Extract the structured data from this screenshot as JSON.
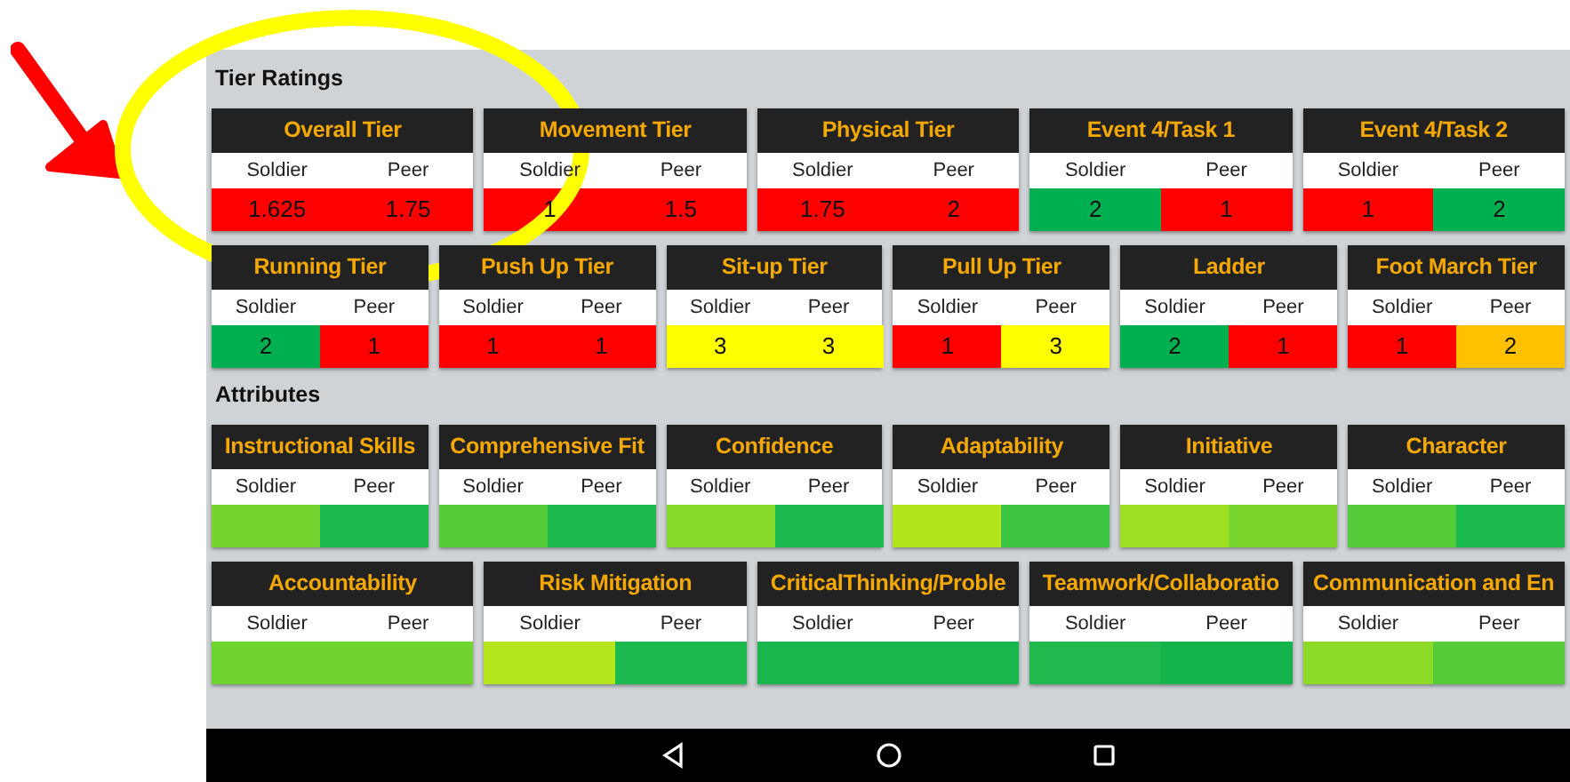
{
  "sections": [
    {
      "title": "Tier Ratings",
      "rows": [
        {
          "cards": [
            {
              "title": "Overall Tier",
              "columns": [
                "Soldier",
                "Peer"
              ],
              "cells": [
                {
                  "value": "1.625",
                  "color": "#ff0000"
                },
                {
                  "value": "1.75",
                  "color": "#ff0000"
                }
              ]
            },
            {
              "title": "Movement Tier",
              "columns": [
                "Soldier",
                "Peer"
              ],
              "cells": [
                {
                  "value": "1",
                  "color": "#ff0000"
                },
                {
                  "value": "1.5",
                  "color": "#ff0000"
                }
              ]
            },
            {
              "title": "Physical Tier",
              "columns": [
                "Soldier",
                "Peer"
              ],
              "cells": [
                {
                  "value": "1.75",
                  "color": "#ff0000"
                },
                {
                  "value": "2",
                  "color": "#ff0000"
                }
              ]
            },
            {
              "title": "Event 4/Task 1",
              "columns": [
                "Soldier",
                "Peer"
              ],
              "cells": [
                {
                  "value": "2",
                  "color": "#00b050"
                },
                {
                  "value": "1",
                  "color": "#ff0000"
                }
              ]
            },
            {
              "title": "Event 4/Task 2",
              "columns": [
                "Soldier",
                "Peer"
              ],
              "cells": [
                {
                  "value": "1",
                  "color": "#ff0000"
                },
                {
                  "value": "2",
                  "color": "#00b050"
                }
              ]
            }
          ]
        },
        {
          "cards": [
            {
              "title": "Running Tier",
              "columns": [
                "Soldier",
                "Peer"
              ],
              "cells": [
                {
                  "value": "2",
                  "color": "#00b050"
                },
                {
                  "value": "1",
                  "color": "#ff0000"
                }
              ]
            },
            {
              "title": "Push Up Tier",
              "columns": [
                "Soldier",
                "Peer"
              ],
              "cells": [
                {
                  "value": "1",
                  "color": "#ff0000"
                },
                {
                  "value": "1",
                  "color": "#ff0000"
                }
              ]
            },
            {
              "title": "Sit-up Tier",
              "columns": [
                "Soldier",
                "Peer"
              ],
              "cells": [
                {
                  "value": "3",
                  "color": "#ffff00"
                },
                {
                  "value": "3",
                  "color": "#ffff00"
                }
              ]
            },
            {
              "title": "Pull Up Tier",
              "columns": [
                "Soldier",
                "Peer"
              ],
              "cells": [
                {
                  "value": "1",
                  "color": "#ff0000"
                },
                {
                  "value": "3",
                  "color": "#ffff00"
                }
              ]
            },
            {
              "title": "Ladder",
              "columns": [
                "Soldier",
                "Peer"
              ],
              "cells": [
                {
                  "value": "2",
                  "color": "#00b050"
                },
                {
                  "value": "1",
                  "color": "#ff0000"
                }
              ]
            },
            {
              "title": "Foot March Tier",
              "columns": [
                "Soldier",
                "Peer"
              ],
              "cells": [
                {
                  "value": "1",
                  "color": "#ff0000"
                },
                {
                  "value": "2",
                  "color": "#ffc000"
                }
              ]
            }
          ]
        }
      ]
    },
    {
      "title": "Attributes",
      "rows": [
        {
          "cards": [
            {
              "title": "Instructional Skills",
              "columns": [
                "Soldier",
                "Peer"
              ],
              "cells": [
                {
                  "color": "#77d42e"
                },
                {
                  "color": "#1cb94e"
                }
              ]
            },
            {
              "title": "Comprehensive Fit",
              "columns": [
                "Soldier",
                "Peer"
              ],
              "cells": [
                {
                  "color": "#56cc3a"
                },
                {
                  "color": "#1cb94e"
                }
              ]
            },
            {
              "title": "Confidence",
              "columns": [
                "Soldier",
                "Peer"
              ],
              "cells": [
                {
                  "color": "#84d92a"
                },
                {
                  "color": "#1cb94e"
                }
              ]
            },
            {
              "title": "Adaptability",
              "columns": [
                "Soldier",
                "Peer"
              ],
              "cells": [
                {
                  "color": "#b2e41e"
                },
                {
                  "color": "#3dc342"
                }
              ]
            },
            {
              "title": "Initiative",
              "columns": [
                "Soldier",
                "Peer"
              ],
              "cells": [
                {
                  "color": "#a0e022"
                },
                {
                  "color": "#7ad62c"
                }
              ]
            },
            {
              "title": "Character",
              "columns": [
                "Soldier",
                "Peer"
              ],
              "cells": [
                {
                  "color": "#56cc3a"
                },
                {
                  "color": "#1cb94e"
                }
              ]
            }
          ]
        },
        {
          "cards": [
            {
              "title": "Accountability",
              "columns": [
                "Soldier",
                "Peer"
              ],
              "cells": [
                {
                  "color": "#70d430"
                },
                {
                  "color": "#70d430"
                }
              ]
            },
            {
              "title": "Risk Mitigation",
              "columns": [
                "Soldier",
                "Peer"
              ],
              "cells": [
                {
                  "color": "#b5e51c"
                },
                {
                  "color": "#1cb94e"
                }
              ]
            },
            {
              "title": "CriticalThinking/Proble",
              "columns": [
                "Soldier",
                "Peer"
              ],
              "cells": [
                {
                  "color": "#18b64c"
                },
                {
                  "color": "#18b64c"
                }
              ]
            },
            {
              "title": "Teamwork/Collaboratio",
              "columns": [
                "Soldier",
                "Peer"
              ],
              "cells": [
                {
                  "color": "#20b94d"
                },
                {
                  "color": "#14b24a"
                }
              ]
            },
            {
              "title": "Communication and En",
              "columns": [
                "Soldier",
                "Peer"
              ],
              "cells": [
                {
                  "color": "#8ddb27"
                },
                {
                  "color": "#56cc3a"
                }
              ]
            }
          ]
        }
      ]
    }
  ]
}
